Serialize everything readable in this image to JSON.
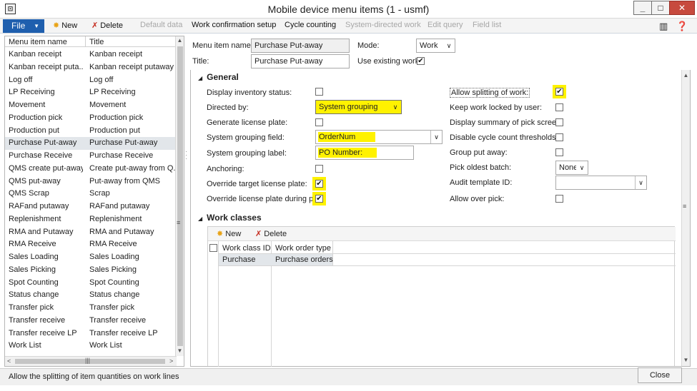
{
  "window": {
    "title": "Mobile device menu items (1 - usmf)",
    "min": "_",
    "max": "□",
    "close": "✕"
  },
  "ribbon": {
    "file": "File",
    "new": "New",
    "delete": "Delete",
    "default_data": "Default data",
    "work_confirmation": "Work confirmation setup",
    "cycle_counting": "Cycle counting",
    "system_directed": "System-directed work",
    "edit_query": "Edit query",
    "field_list": "Field list"
  },
  "list": {
    "col1": "Menu item name",
    "col2": "Title",
    "rows": [
      {
        "name": "Kanban receipt",
        "title": "Kanban receipt"
      },
      {
        "name": "Kanban receipt puta...",
        "title": "Kanban receipt putaway"
      },
      {
        "name": "Log off",
        "title": "Log off"
      },
      {
        "name": "LP Receiving",
        "title": "LP Receiving"
      },
      {
        "name": "Movement",
        "title": "Movement"
      },
      {
        "name": "Production pick",
        "title": "Production pick"
      },
      {
        "name": "Production put",
        "title": "Production put"
      },
      {
        "name": "Purchase Put-away",
        "title": "Purchase Put-away"
      },
      {
        "name": "Purchase Receive",
        "title": "Purchase Receive"
      },
      {
        "name": "QMS create put-away",
        "title": "Create put-away from Q..."
      },
      {
        "name": "QMS put-away",
        "title": "Put-away from QMS"
      },
      {
        "name": "QMS Scrap",
        "title": "Scrap"
      },
      {
        "name": "RAFand putaway",
        "title": "RAFand putaway"
      },
      {
        "name": "Replenishment",
        "title": "Replenishment"
      },
      {
        "name": "RMA and Putaway",
        "title": "RMA and Putaway"
      },
      {
        "name": "RMA Receive",
        "title": "RMA Receive"
      },
      {
        "name": "Sales Loading",
        "title": "Sales Loading"
      },
      {
        "name": "Sales Picking",
        "title": "Sales Picking"
      },
      {
        "name": "Spot Counting",
        "title": "Spot Counting"
      },
      {
        "name": "Status change",
        "title": "Status change"
      },
      {
        "name": "Transfer pick",
        "title": "Transfer pick"
      },
      {
        "name": "Transfer receive",
        "title": "Transfer receive"
      },
      {
        "name": "Transfer receive LP",
        "title": "Transfer receive LP"
      },
      {
        "name": "Work List",
        "title": "Work List"
      }
    ],
    "selected_index": 7
  },
  "header": {
    "menu_item_name_label": "Menu item name:",
    "menu_item_name": "Purchase Put-away",
    "title_label": "Title:",
    "title": "Purchase Put-away",
    "mode_label": "Mode:",
    "mode": "Work",
    "use_existing_label": "Use existing work:",
    "use_existing": true
  },
  "general": {
    "section": "General",
    "display_inventory_label": "Display inventory status:",
    "display_inventory": false,
    "directed_by_label": "Directed by:",
    "directed_by": "System grouping",
    "generate_lp_label": "Generate license plate:",
    "generate_lp": false,
    "grouping_field_label": "System grouping field:",
    "grouping_field": "OrderNum",
    "grouping_label_label": "System grouping label:",
    "grouping_label": "PO Number:",
    "anchoring_label": "Anchoring:",
    "anchoring": false,
    "override_target_label": "Override target license plate:",
    "override_target": true,
    "override_put_label": "Override license plate during put:",
    "override_put": true,
    "allow_split_label": "Allow splitting of work:",
    "allow_split": true,
    "keep_locked_label": "Keep work locked by user:",
    "keep_locked": false,
    "display_summary_label": "Display summary of pick screen:",
    "display_summary": false,
    "disable_cycle_label": "Disable cycle count thresholds:",
    "disable_cycle": false,
    "group_put_label": "Group put away:",
    "group_put": false,
    "pick_oldest_label": "Pick oldest batch:",
    "pick_oldest": "None",
    "audit_template_label": "Audit template ID:",
    "audit_template": "",
    "allow_over_label": "Allow over pick:",
    "allow_over": false
  },
  "work_classes": {
    "section": "Work classes",
    "new": "New",
    "delete": "Delete",
    "col1": "Work class ID",
    "col2": "Work order type",
    "rows": [
      {
        "id": "Purchase",
        "type": "Purchase orders"
      }
    ]
  },
  "status": {
    "message": "Allow the splitting of item quantities on work lines",
    "close": "Close"
  }
}
